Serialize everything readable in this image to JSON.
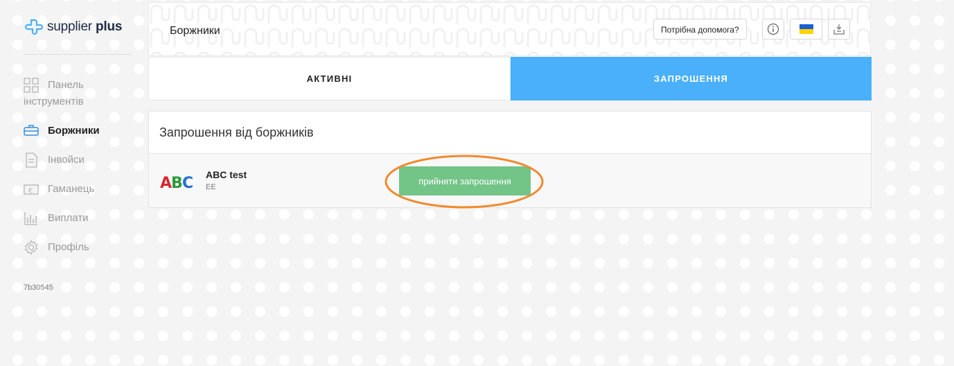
{
  "brand": {
    "name_light": "supplier",
    "name_bold": "plus"
  },
  "sidebar": {
    "items": [
      {
        "label": "Панель",
        "label_line2": "інструментів",
        "icon": "dashboard-icon",
        "active": false
      },
      {
        "label": "Боржники",
        "icon": "debtors-icon",
        "active": true
      },
      {
        "label": "Інвойси",
        "icon": "invoice-icon",
        "active": false
      },
      {
        "label": "Гаманець",
        "icon": "wallet-icon",
        "active": false
      },
      {
        "label": "Виплати",
        "icon": "payouts-icon",
        "active": false
      },
      {
        "label": "Профіль",
        "icon": "gear-icon",
        "active": false
      }
    ],
    "version": "7b30545"
  },
  "header": {
    "title": "Боржники",
    "help_label": "Потрібна допомога?",
    "icons": [
      "info-icon",
      "ukraine-flag-icon",
      "export-icon"
    ]
  },
  "tabs": [
    {
      "label": "АКТИВНІ",
      "active": false
    },
    {
      "label": "ЗАПРОШЕННЯ",
      "active": true
    }
  ],
  "invitations": {
    "heading": "Запрошення від боржників",
    "rows": [
      {
        "logo_text": "ABC",
        "name": "ABC test",
        "country": "EE",
        "accept_label": "прийняти запрошення"
      }
    ]
  },
  "colors": {
    "accent": "#4ab0fb",
    "accept": "#72c487",
    "annotation": "#f08a2c",
    "flag_blue": "#1a5fd6",
    "flag_yellow": "#ffd400"
  }
}
